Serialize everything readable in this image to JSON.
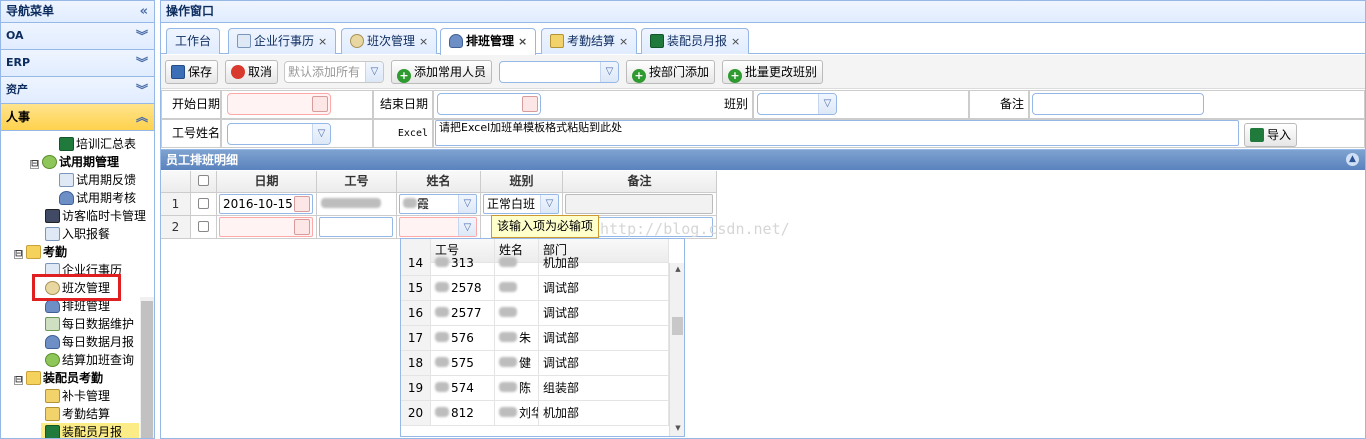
{
  "sidebar": {
    "title": "导航菜单",
    "collapse_icon": "double-chevron-left",
    "sections": [
      {
        "label": "OA"
      },
      {
        "label": "ERP"
      },
      {
        "label": "资产"
      },
      {
        "label": "人事"
      }
    ],
    "tree": [
      {
        "label": "培训汇总表",
        "icon": "excel"
      },
      {
        "label": "试用期管理",
        "icon": "clock",
        "expander": "⊟"
      },
      {
        "label": "试用期反馈",
        "icon": "doc"
      },
      {
        "label": "试用期考核",
        "icon": "user"
      },
      {
        "label": "访客临时卡管理",
        "icon": "card"
      },
      {
        "label": "入职报餐",
        "icon": "doc"
      },
      {
        "label": "考勤",
        "icon": "folder",
        "expander": "⊟"
      },
      {
        "label": "企业行事历",
        "icon": "doc"
      },
      {
        "label": "班次管理",
        "icon": "gear"
      },
      {
        "label": "排班管理",
        "icon": "user"
      },
      {
        "label": "每日数据维护",
        "icon": "grid"
      },
      {
        "label": "每日数据月报",
        "icon": "user"
      },
      {
        "label": "结算加班查询",
        "icon": "clock"
      },
      {
        "label": "装配员考勤",
        "icon": "folder",
        "expander": "⊟"
      },
      {
        "label": "补卡管理",
        "icon": "pencil"
      },
      {
        "label": "考勤结算",
        "icon": "pencil"
      },
      {
        "label": "装配员月报",
        "icon": "excel"
      }
    ]
  },
  "main": {
    "title": "操作窗口",
    "tabs": [
      {
        "label": "工作台"
      },
      {
        "label": "企业行事历"
      },
      {
        "label": "班次管理"
      },
      {
        "label": "排班管理"
      },
      {
        "label": "考勤结算"
      },
      {
        "label": "装配员月报"
      }
    ],
    "close_glyph": "×"
  },
  "toolbar": {
    "save": "保存",
    "cancel": "取消",
    "default_add_all": "默认添加所有",
    "add_common": "添加常用人员",
    "dept_combo": "",
    "add_by_dept": "按部门添加",
    "batch_change": "批量更改班别"
  },
  "form": {
    "start_date_label": "开始日期",
    "start_date": "",
    "end_date_label": "结束日期",
    "end_date": "",
    "shift_label": "班别",
    "shift": "",
    "remark_label": "备注",
    "remark": "",
    "emp_label": "工号姓名",
    "emp": "",
    "excel_label": "Excel",
    "excel_text": "请把Excel加班单模板格式粘贴到此处",
    "import": "导入"
  },
  "grid": {
    "title": "员工排班明细",
    "columns": [
      "日期",
      "工号",
      "姓名",
      "班别",
      "备注"
    ],
    "rows": [
      {
        "num": "1",
        "date": "2016-10-15",
        "name_suffix": "霞",
        "shift": "正常白班",
        "remark": ""
      },
      {
        "num": "2",
        "date": "",
        "name_suffix": "",
        "shift": "",
        "remark": ""
      }
    ],
    "tooltip": "该输入项为必输项"
  },
  "watermark": "http://blog.csdn.net/",
  "dropdown": {
    "columns": [
      "工号",
      "姓名",
      "部门"
    ],
    "rows": [
      {
        "num": "14",
        "id": "313",
        "name": "",
        "dept": "机加部"
      },
      {
        "num": "15",
        "id": "2578",
        "name": "",
        "dept": "调试部"
      },
      {
        "num": "16",
        "id": "2577",
        "name": "",
        "dept": "调试部"
      },
      {
        "num": "17",
        "id": "576",
        "name": "朱",
        "dept": "调试部"
      },
      {
        "num": "18",
        "id": "575",
        "name": "健",
        "dept": "调试部"
      },
      {
        "num": "19",
        "id": "574",
        "name": "陈",
        "dept": "组装部"
      },
      {
        "num": "20",
        "id": "812",
        "name": "刘华",
        "dept": "机加部"
      }
    ]
  },
  "colors": {
    "accent_border": "#95b8e7",
    "active_section": "#ffd24d",
    "highlight_box": "#e02020"
  }
}
